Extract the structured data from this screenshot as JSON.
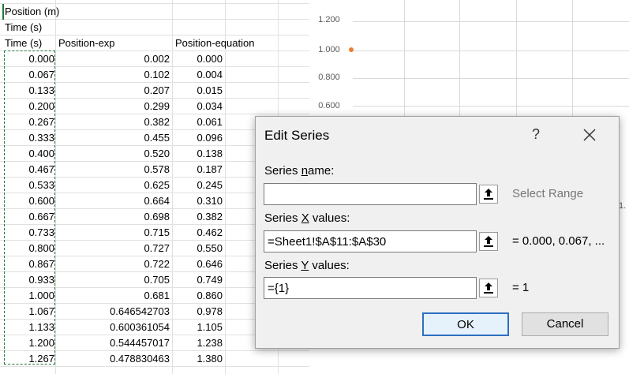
{
  "sheet": {
    "row1": "Position (m)",
    "row2": "Time (s)",
    "headers": [
      "Time (s)",
      "Position-exp",
      "Position-equation"
    ],
    "rows": [
      [
        "0.000",
        "0.002",
        "0.000"
      ],
      [
        "0.067",
        "0.102",
        "0.004"
      ],
      [
        "0.133",
        "0.207",
        "0.015"
      ],
      [
        "0.200",
        "0.299",
        "0.034"
      ],
      [
        "0.267",
        "0.382",
        "0.061"
      ],
      [
        "0.333",
        "0.455",
        "0.096"
      ],
      [
        "0.400",
        "0.520",
        "0.138"
      ],
      [
        "0.467",
        "0.578",
        "0.187"
      ],
      [
        "0.533",
        "0.625",
        "0.245"
      ],
      [
        "0.600",
        "0.664",
        "0.310"
      ],
      [
        "0.667",
        "0.698",
        "0.382"
      ],
      [
        "0.733",
        "0.715",
        "0.462"
      ],
      [
        "0.800",
        "0.727",
        "0.550"
      ],
      [
        "0.867",
        "0.722",
        "0.646"
      ],
      [
        "0.933",
        "0.705",
        "0.749"
      ],
      [
        "1.000",
        "0.681",
        "0.860"
      ],
      [
        "1.067",
        "0.646542703",
        "0.978"
      ],
      [
        "1.133",
        "0.600361054",
        "1.105"
      ],
      [
        "1.200",
        "0.544457017",
        "1.238"
      ],
      [
        "1.267",
        "0.478830463",
        "1.380"
      ]
    ]
  },
  "chart": {
    "yticks": [
      "1.200",
      "1.000",
      "0.800",
      "0.600"
    ],
    "point_value": 1.0,
    "edge_label": "1."
  },
  "dialog": {
    "title": "Edit Series",
    "help": "?",
    "series_name_label_pre": "Series ",
    "series_name_label_key": "n",
    "series_name_label_post": "ame:",
    "series_name_value": "",
    "select_range": "Select Range",
    "x_label_pre": "Series ",
    "x_label_key": "X",
    "x_label_post": " values:",
    "x_value": "=Sheet1!$A$11:$A$30",
    "x_preview": "= 0.000, 0.067, ...",
    "y_label_pre": "Series ",
    "y_label_key": "Y",
    "y_label_post": " values:",
    "y_value": "={1}",
    "y_preview": "= 1",
    "ok": "OK",
    "cancel": "Cancel"
  },
  "colors": {
    "point": "#ed7d31",
    "accent": "#2d6fc0",
    "marquee": "#1f7a3a"
  }
}
